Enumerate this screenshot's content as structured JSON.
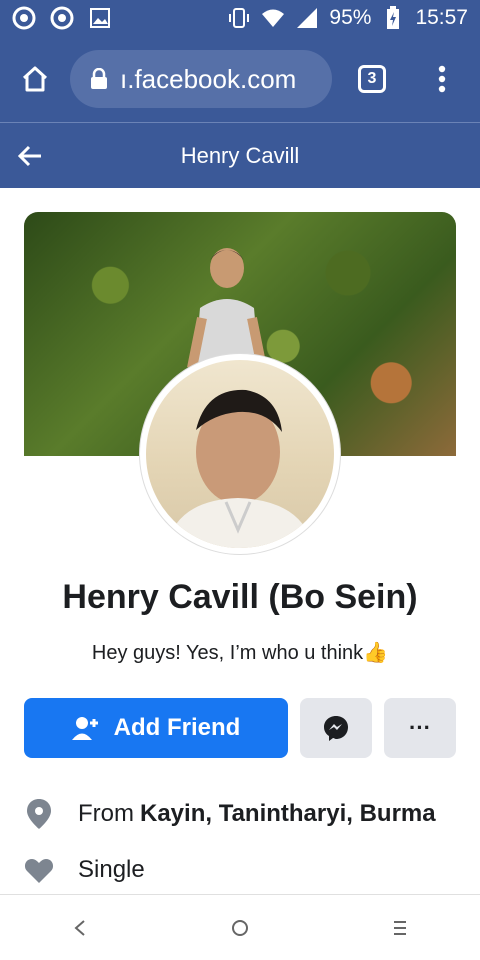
{
  "status_bar": {
    "battery": "95%",
    "time": "15:57"
  },
  "browser": {
    "url": "ı.facebook.com",
    "tab_count": "3"
  },
  "header": {
    "title": "Henry Cavill"
  },
  "profile": {
    "name": "Henry Cavill (Bo Sein)",
    "bio": "Hey guys! Yes, I’m who u think",
    "bio_emoji": "👍"
  },
  "actions": {
    "add_friend": "Add Friend",
    "more": "···"
  },
  "info": {
    "from_prefix": "From",
    "from_place": "Kayin, Tanintharyi, Burma",
    "relationship": "Single"
  },
  "colors": {
    "brand": "#3b5998",
    "primary_button": "#1877f2",
    "secondary_button": "#e4e6eb"
  }
}
